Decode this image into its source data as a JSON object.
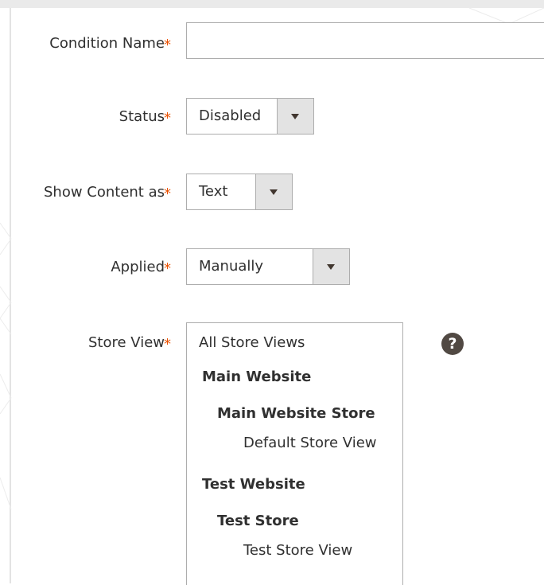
{
  "form": {
    "condition_name": {
      "label": "Condition Name",
      "required": "*",
      "value": ""
    },
    "status": {
      "label": "Status",
      "required": "*",
      "value": "Disabled"
    },
    "show_content_as": {
      "label": "Show Content as",
      "required": "*",
      "value": "Text"
    },
    "applied": {
      "label": "Applied",
      "required": "*",
      "value": "Manually"
    },
    "store_view": {
      "label": "Store View",
      "required": "*",
      "help": "?",
      "options": [
        {
          "label": "All Store Views",
          "level": 0,
          "bold": false
        },
        {
          "label": "Main Website",
          "level": 1,
          "bold": true
        },
        {
          "label": "Main Website Store",
          "level": 2,
          "bold": true
        },
        {
          "label": "Default Store View",
          "level": 3,
          "bold": false
        },
        {
          "label": "Test Website",
          "level": 1,
          "bold": true
        },
        {
          "label": "Test Store",
          "level": 2,
          "bold": true
        },
        {
          "label": "Test Store View",
          "level": 3,
          "bold": false
        }
      ]
    }
  },
  "colors": {
    "required": "#eb5202",
    "border": "#adadad",
    "arrow_bg": "#e3e3e3",
    "help_bg": "#514943"
  }
}
